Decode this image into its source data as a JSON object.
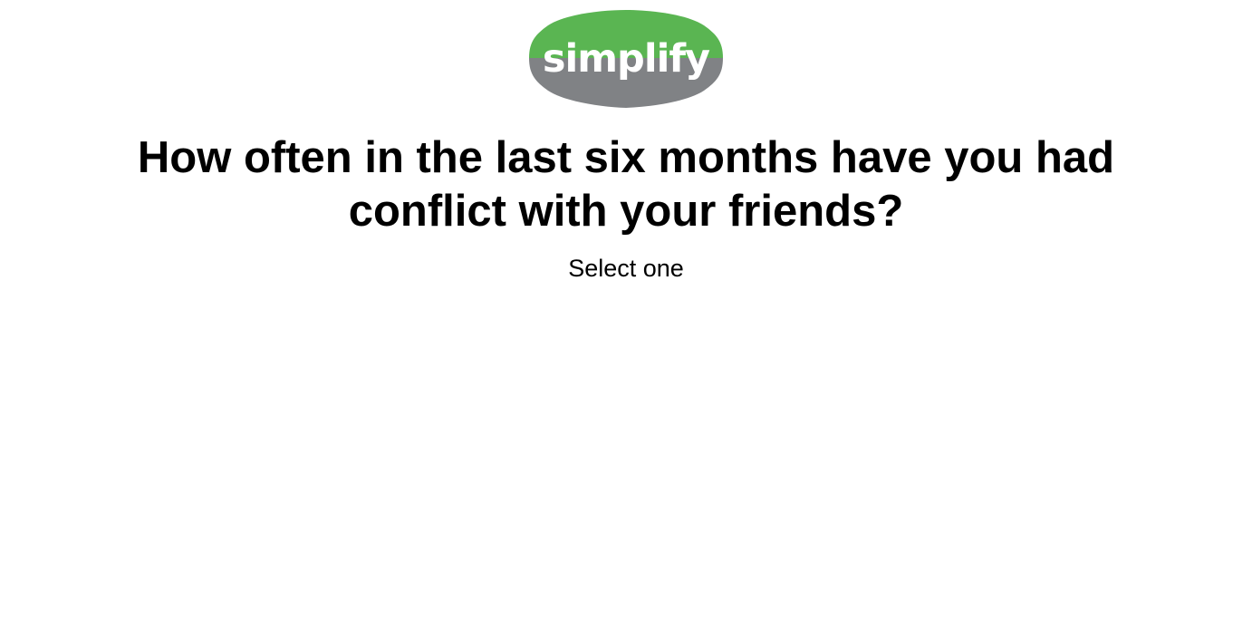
{
  "logo": {
    "text": "simplify",
    "color_top": "#5ab552",
    "color_bottom": "#808285",
    "text_color": "#ffffff"
  },
  "question": {
    "text": "How often in the last six months have you had conflict with your friends?"
  },
  "instruction": {
    "text": "Select one"
  }
}
